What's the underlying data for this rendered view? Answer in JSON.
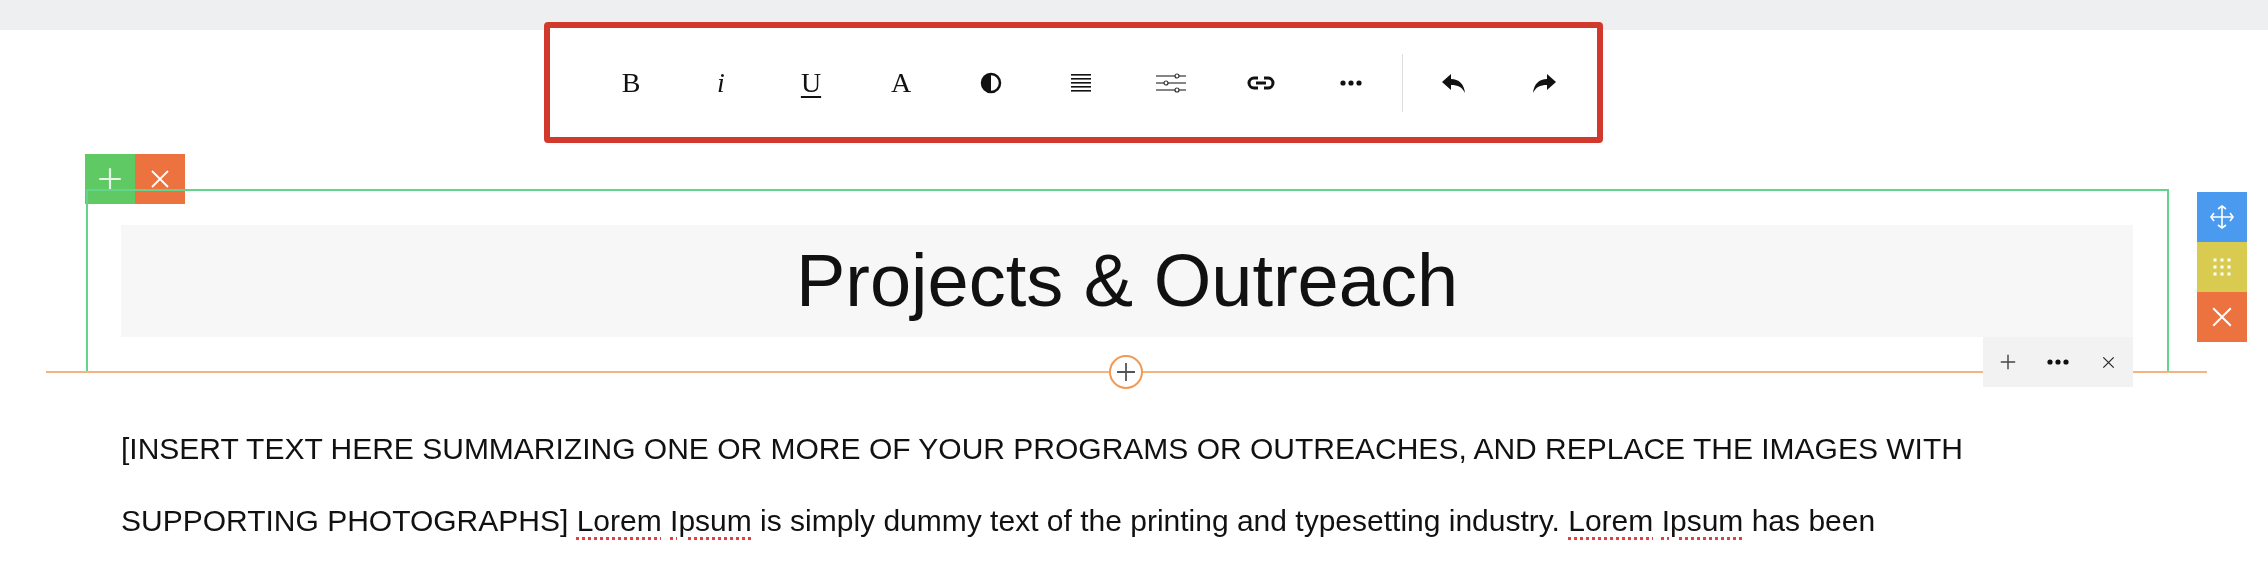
{
  "format_toolbar": {
    "text_buttons": [
      {
        "label": "B",
        "kind": "bold"
      },
      {
        "label": "i",
        "kind": "italic"
      },
      {
        "label": "U",
        "kind": "underline"
      },
      {
        "label": "A",
        "kind": "font"
      }
    ],
    "icon_buttons": [
      {
        "kind": "contrast"
      },
      {
        "kind": "align"
      },
      {
        "kind": "sliders"
      },
      {
        "kind": "link"
      },
      {
        "kind": "more"
      }
    ],
    "history_buttons": [
      {
        "kind": "undo"
      },
      {
        "kind": "redo"
      }
    ]
  },
  "section": {
    "title": "Projects & Outreach"
  },
  "paragraph": {
    "lines": [
      [
        {
          "text": "[INSERT TEXT HERE SUMMARIZING ONE OR MORE OF YOUR PROGRAMS OR OUTREACHES, AND REPLACE THE IMAGES WITH",
          "misspelled": false
        }
      ],
      [
        {
          "text": "SUPPORTING PHOTOGRAPHS]",
          "misspelled": false
        },
        {
          "text": "Lorem",
          "misspelled": true
        },
        {
          "text": "Ipsum",
          "misspelled": true
        },
        {
          "text": "is simply dummy text of the printing and typesetting industry.",
          "misspelled": false
        },
        {
          "text": "Lorem",
          "misspelled": true
        },
        {
          "text": "Ipsum",
          "misspelled": true
        },
        {
          "text": "has been",
          "misspelled": false
        }
      ]
    ]
  }
}
